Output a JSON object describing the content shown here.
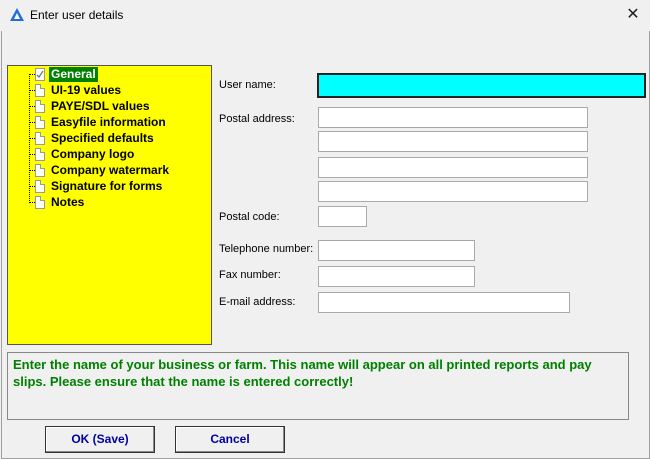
{
  "window": {
    "title": "Enter user details",
    "close_glyph": "✕"
  },
  "tree": {
    "items": [
      {
        "label": "General",
        "selected": true
      },
      {
        "label": "UI-19 values"
      },
      {
        "label": "PAYE/SDL values"
      },
      {
        "label": "Easyfile information"
      },
      {
        "label": "Specified defaults"
      },
      {
        "label": "Company logo"
      },
      {
        "label": "Company watermark"
      },
      {
        "label": "Signature for forms"
      },
      {
        "label": "Notes"
      }
    ]
  },
  "form": {
    "user_name_label": "User name:",
    "postal_address_label": "Postal address:",
    "postal_code_label": "Postal code:",
    "telephone_label": "Telephone number:",
    "fax_label": "Fax number:",
    "email_label": "E-mail address:",
    "user_name": "",
    "postal_address": [
      "",
      "",
      "",
      ""
    ],
    "postal_code": "",
    "telephone": "",
    "fax": "",
    "email": ""
  },
  "message": "Enter the name of your business or farm.  This name will appear on all printed reports and pay slips.  Please ensure that the name is entered correctly!",
  "buttons": {
    "ok": "OK (Save)",
    "cancel": "Cancel"
  },
  "colors": {
    "tree_bg": "#ffff00",
    "selected": "#008000",
    "active_field": "#00ffff",
    "message_text": "#008000",
    "button_text": "#0000a0"
  }
}
